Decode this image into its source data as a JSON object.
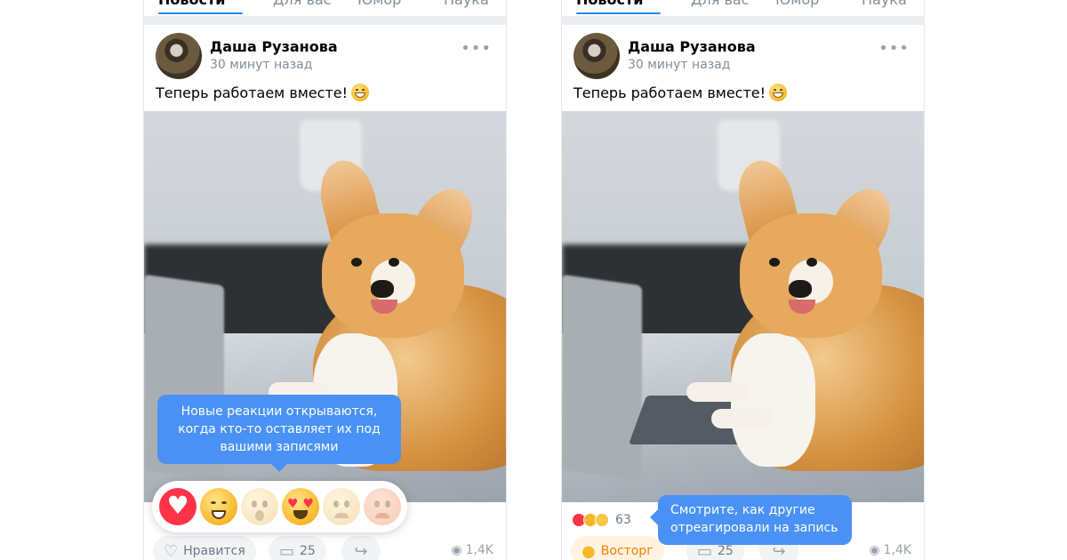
{
  "tabs": [
    {
      "label": "Новости"
    },
    {
      "label": "Для вас"
    },
    {
      "label": "Юмор"
    },
    {
      "label": "Наука"
    }
  ],
  "post": {
    "author": "Даша Рузанова",
    "time": "30 минут назад",
    "text": "Теперь работаем вместе!",
    "more_icon": "•••"
  },
  "left": {
    "tooltip": "Новые реакции открываются, когда кто-то оставляет их под вашими записями",
    "reactions": [
      {
        "name": "heart-icon"
      },
      {
        "name": "laugh-icon"
      },
      {
        "name": "wow-icon",
        "state": "locked"
      },
      {
        "name": "love-eyes-icon"
      },
      {
        "name": "sad-icon",
        "state": "locked"
      },
      {
        "name": "angry-icon",
        "state": "locked"
      }
    ],
    "like_label": "Нравится",
    "comments": "25",
    "views": "1,4K"
  },
  "right": {
    "tooltip": "Смотрите, как другие отреагировали на запись",
    "reactions_count": "63",
    "reaction_label": "Восторг",
    "comments": "25",
    "views": "1,4K"
  },
  "colors": {
    "accent": "#2688eb",
    "tooltip": "#4a91f5",
    "heart": "#ff3347",
    "active_reaction": "#f27f00"
  }
}
